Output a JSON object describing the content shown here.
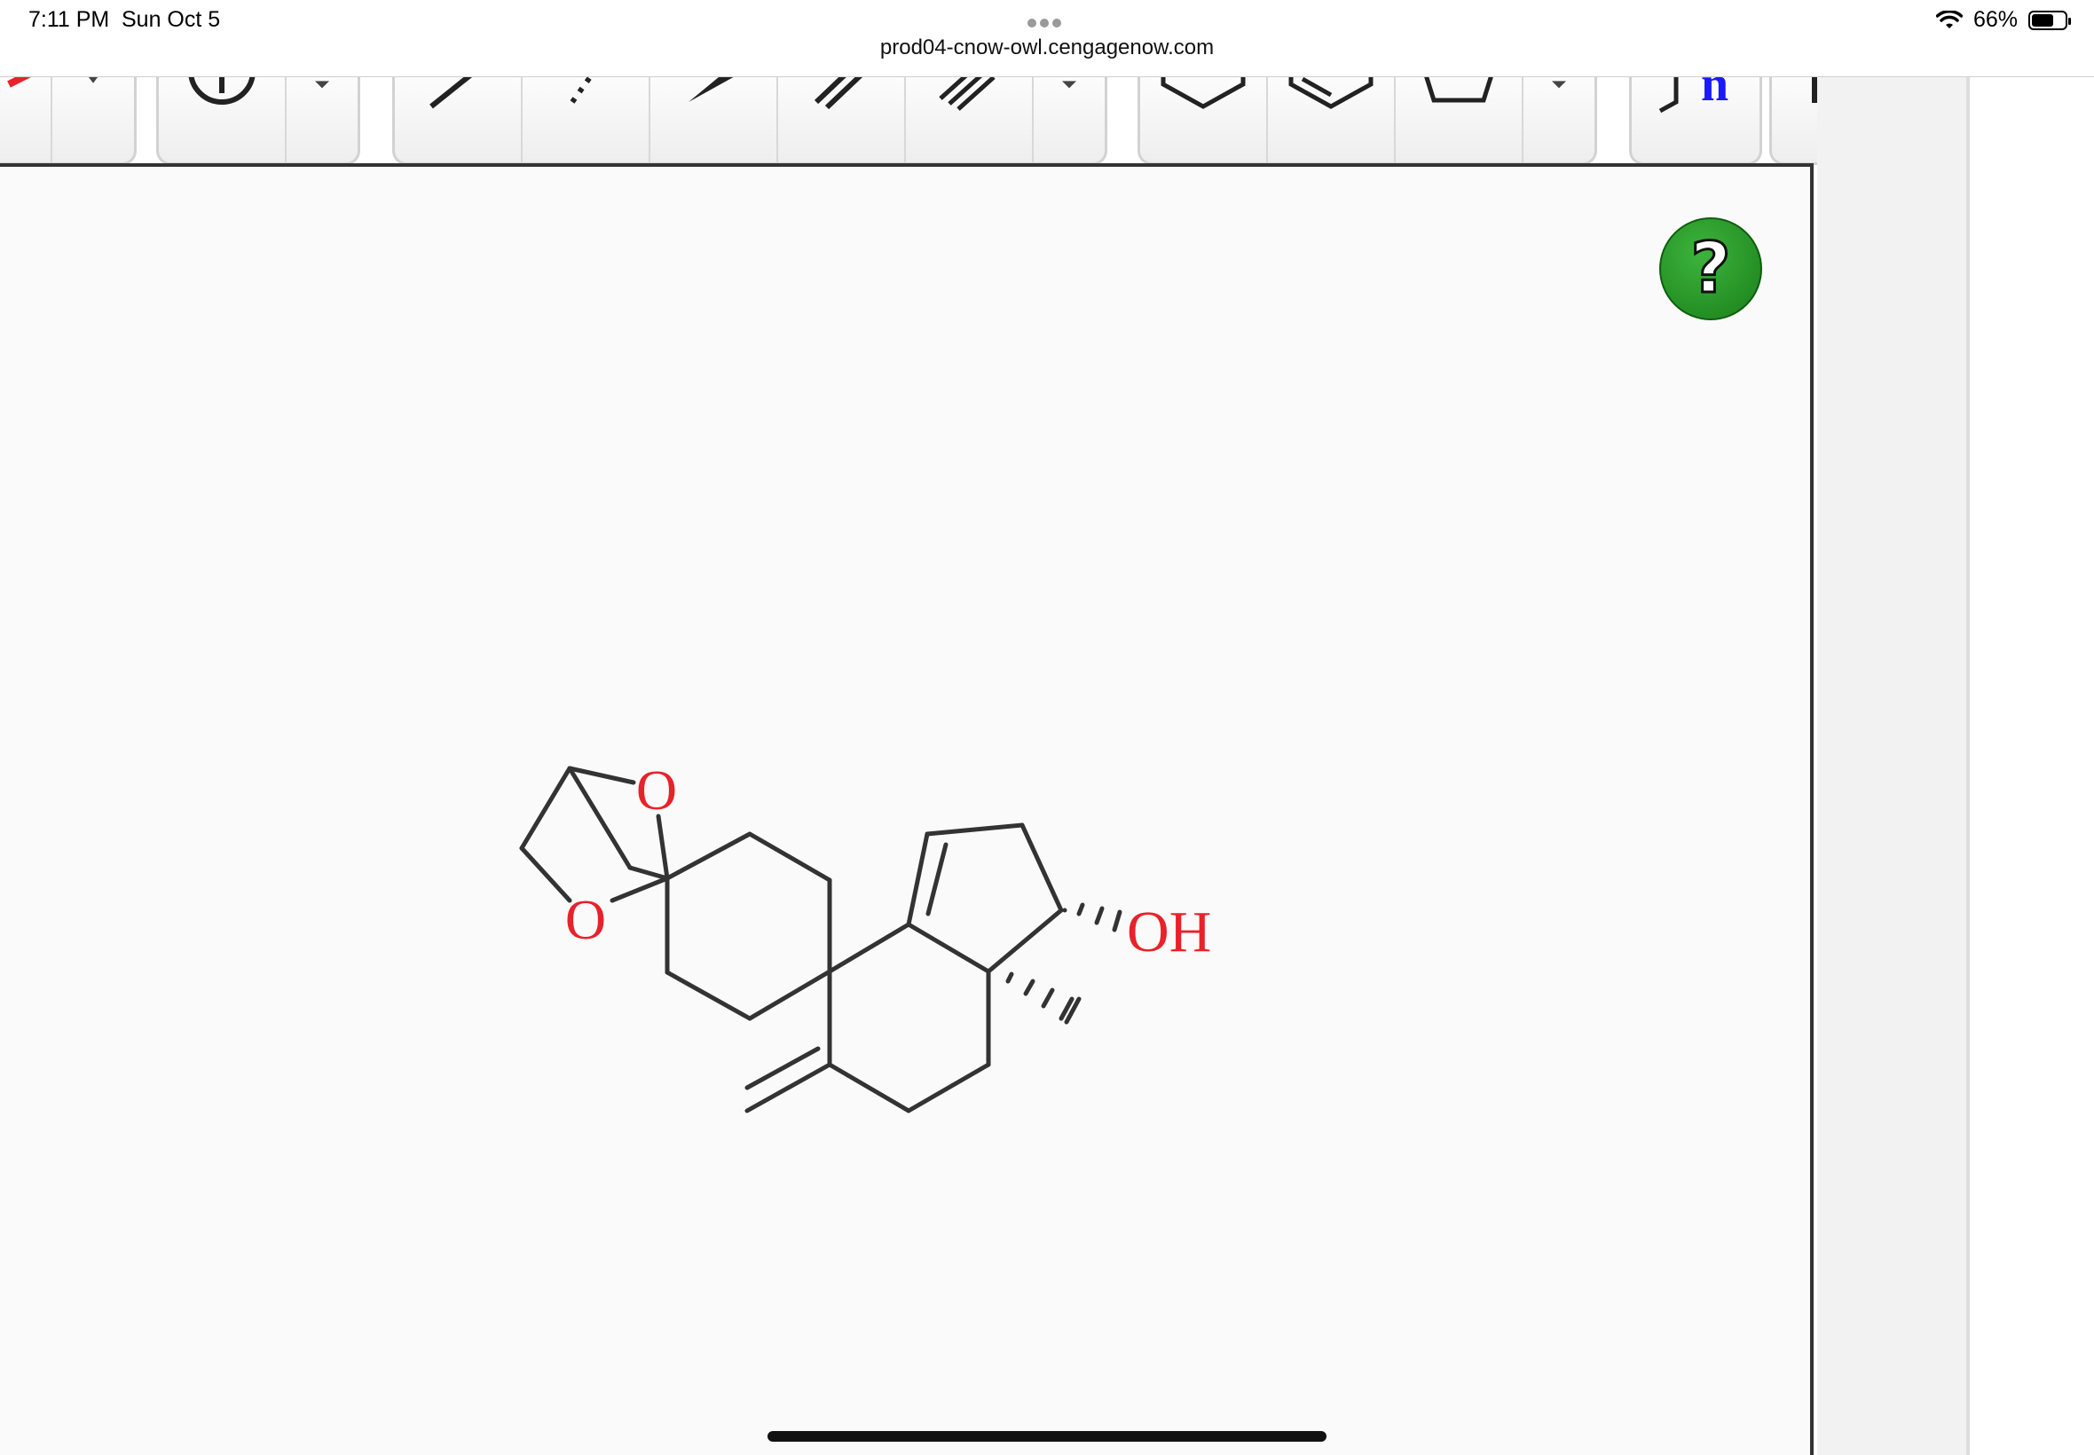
{
  "status_bar": {
    "time": "7:11 PM",
    "date": "Sun Oct 5",
    "url": "prod04-cnow-owl.cengagenow.com",
    "battery": "66%",
    "battery_level": 0.66
  },
  "toolbar": {
    "groups": [
      {
        "name": "erase-group",
        "tools": [
          "eraser-icon",
          "dropdown-icon"
        ]
      },
      {
        "name": "charge-group",
        "tools": [
          "charge-icon",
          "dropdown-icon"
        ]
      },
      {
        "name": "bond-group",
        "tools": [
          "single-bond-icon",
          "dashed-bond-icon",
          "wedge-bond-icon",
          "double-bond-icon",
          "triple-bond-icon",
          "dropdown-icon"
        ]
      },
      {
        "name": "ring-group",
        "tools": [
          "cyclohexane-icon",
          "benzene-icon",
          "cyclopentane-icon",
          "dropdown-icon"
        ]
      },
      {
        "name": "bracket-group",
        "tools": [
          "repeat-unit-icon",
          "bracket-icon"
        ]
      }
    ],
    "repeat_unit_label": "n"
  },
  "canvas": {
    "help_label": "?",
    "molecule": {
      "labels": {
        "o_top": "O",
        "o_bottom": "O",
        "oh": "OH"
      },
      "colors": {
        "bond": "#333333",
        "heteroatom": "#e8222a"
      }
    }
  },
  "colors": {
    "help_green": "#22a022",
    "repeat_unit_blue": "#1a1aff"
  }
}
